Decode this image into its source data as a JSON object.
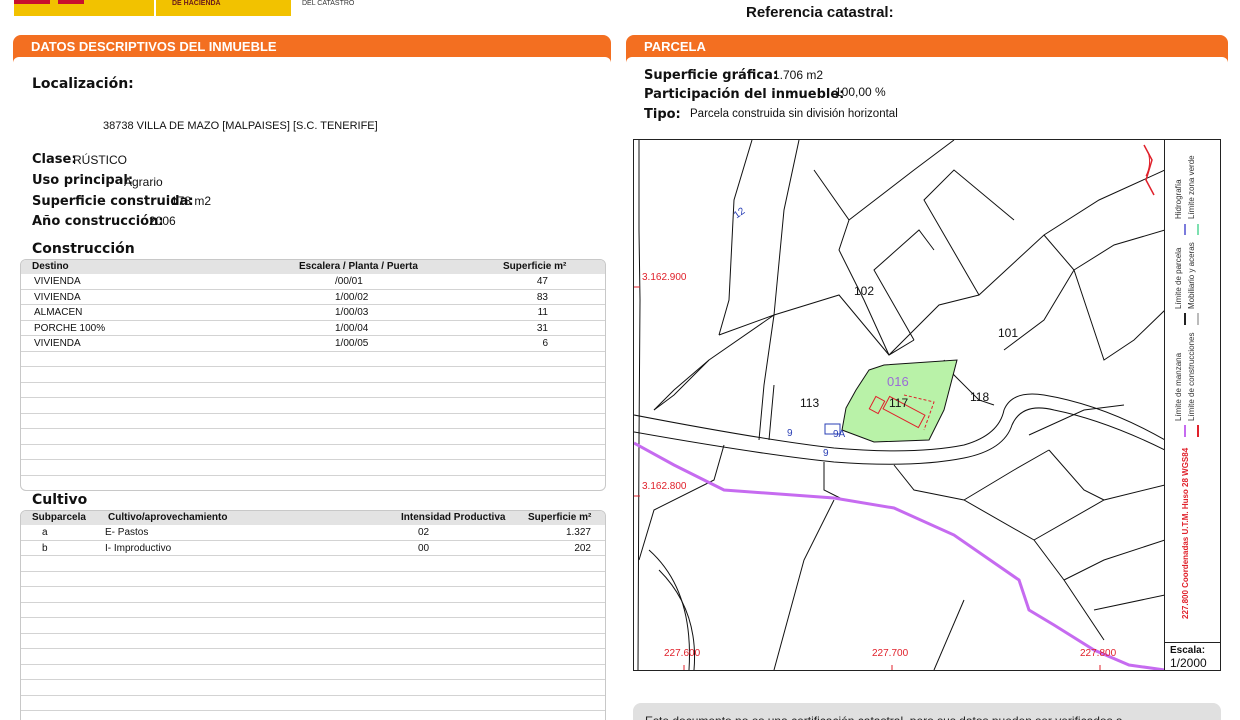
{
  "header": {
    "ministry": "DE HACIENDA",
    "catastro": "DEL CATASTRO",
    "referencia_title": "Referencia catastral:"
  },
  "left": {
    "section_title": "DATOS DESCRIPTIVOS DEL INMUEBLE",
    "localizacion_label": "Localización:",
    "localizacion_value": "38738 VILLA DE MAZO [MALPAISES] [S.C. TENERIFE]",
    "clase_label": "Clase:",
    "clase_value": "RÚSTICO",
    "uso_label": "Uso principal:",
    "uso_value": "Agrario",
    "superficie_label": "Superficie construida:",
    "superficie_value": "178 m2",
    "anio_label": "Año construcción:",
    "anio_value": "2006",
    "construccion": {
      "title": "Construcción",
      "headers": [
        "Destino",
        "Escalera / Planta / Puerta",
        "Superficie m²"
      ],
      "rows": [
        [
          "VIVIENDA",
          "/00/01",
          "47"
        ],
        [
          "VIVIENDA",
          "1/00/02",
          "83"
        ],
        [
          "ALMACEN",
          "1/00/03",
          "11"
        ],
        [
          "PORCHE 100%",
          "1/00/04",
          "31"
        ],
        [
          "VIVIENDA",
          "1/00/05",
          "6"
        ]
      ]
    },
    "cultivo": {
      "title": "Cultivo",
      "headers": [
        "Subparcela",
        "Cultivo/aprovechamiento",
        "Intensidad Productiva",
        "Superficie m²"
      ],
      "rows": [
        [
          "a",
          "E- Pastos",
          "02",
          "1.327"
        ],
        [
          "b",
          "I- Improductivo",
          "00",
          "202"
        ]
      ]
    }
  },
  "right": {
    "section_title": "PARCELA",
    "sup_grafica_label": "Superficie gráfica:",
    "sup_grafica_value": "1.706 m2",
    "participacion_label": "Participación del inmueble:",
    "participacion_value": "100,00 %",
    "tipo_label": "Tipo:",
    "tipo_value": "Parcela construida sin división horizontal"
  },
  "map": {
    "parcel_numbers": [
      "102",
      "101",
      "113",
      "118",
      "117",
      "016",
      "12",
      "9",
      "9A",
      "9"
    ],
    "coord_y": [
      "3.162.900",
      "3.162.800"
    ],
    "coord_x": [
      "227.600",
      "227.700",
      "227.800"
    ],
    "legend": {
      "hidrografia": "Hidrografía",
      "zona_verde": "Límite zona verde",
      "limite_parcela": "Límite de parcela",
      "mobiliario": "Mobiliario y aceras",
      "limite_manzana": "Límite de manzana",
      "limite_construcciones": "Límite de construcciones",
      "coordenadas": "227.800 Coordenadas U.T.M. Huso 28 WGS84"
    },
    "scale_label": "Escala:",
    "scale_value": "1/2000",
    "colors": {
      "parcel_fill": "#b9f2a8",
      "coord": "#e0212b",
      "river": "#c66bf0",
      "subparcel_label": "#9a6cd6",
      "block_num": "#2a3fb5"
    }
  },
  "notice": "Este documento no es una certificación catastral, pero sus datos pueden ser verificados a"
}
